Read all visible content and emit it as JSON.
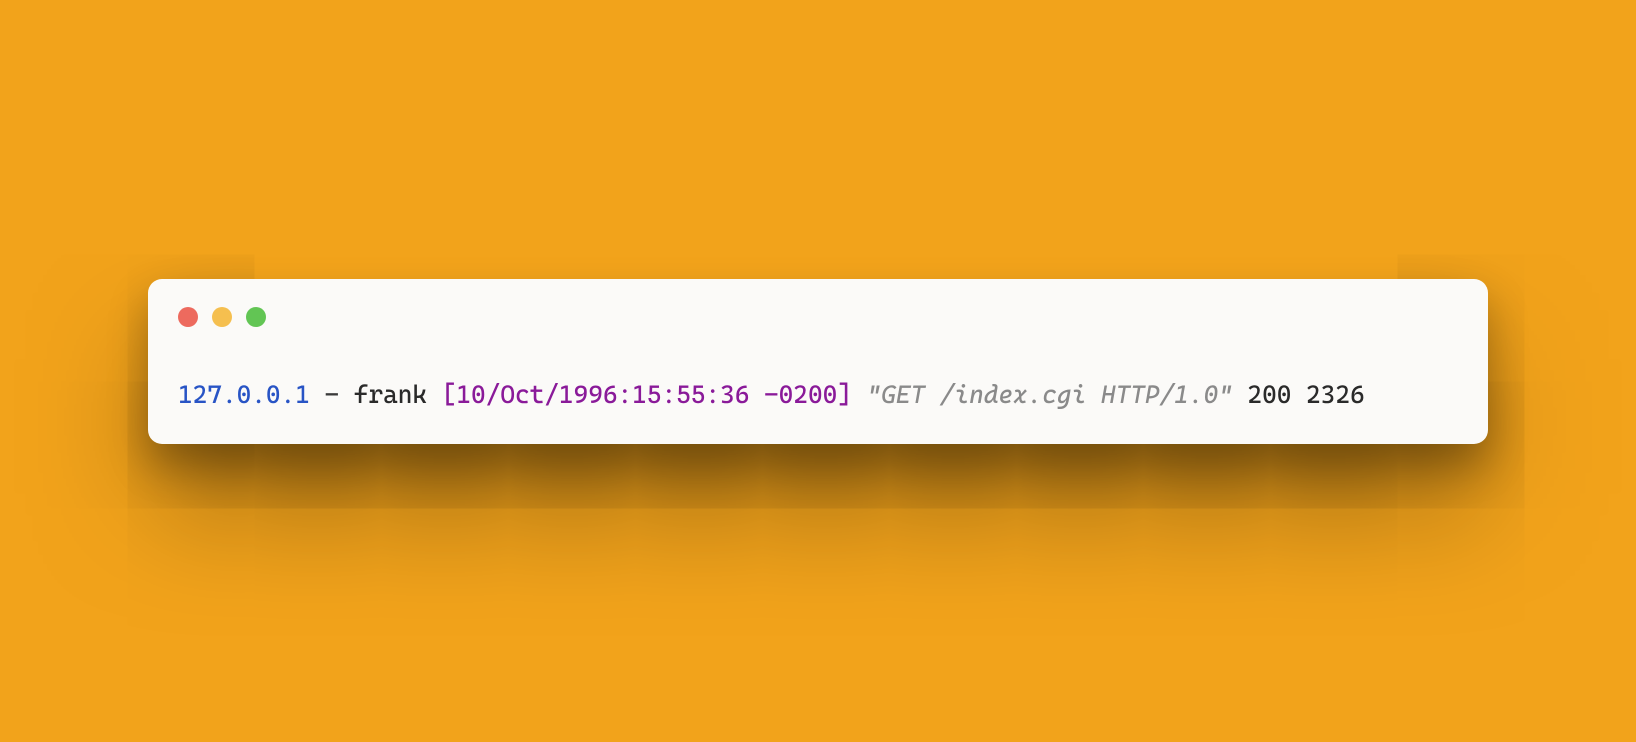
{
  "log": {
    "ip": "127.0.0.1",
    "dash": "-",
    "user": "frank",
    "date_open": "[10/Oct/1996:15:55:36",
    "date_offset": "-0200]",
    "request": "\"GET /index.cgi HTTP/1.0\"",
    "status": "200",
    "size": "2326"
  }
}
